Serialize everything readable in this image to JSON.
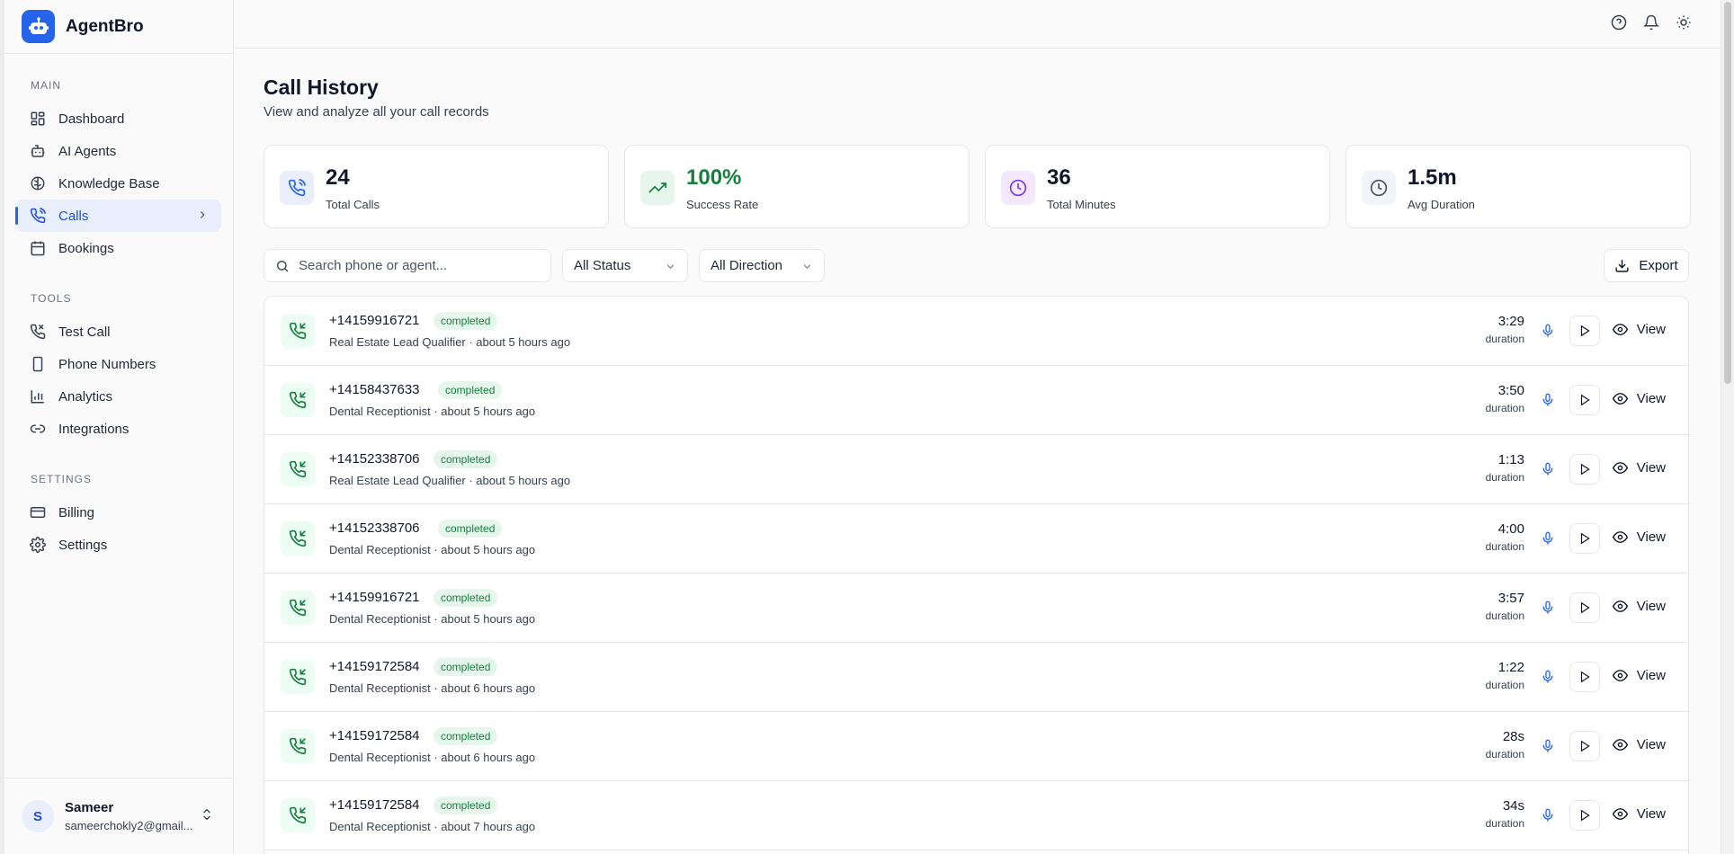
{
  "app": {
    "name": "AgentBro"
  },
  "sidebar": {
    "sections": [
      {
        "label": "MAIN",
        "items": [
          {
            "label": "Dashboard",
            "icon": "dashboard-icon"
          },
          {
            "label": "AI Agents",
            "icon": "robot-icon"
          },
          {
            "label": "Knowledge Base",
            "icon": "brain-icon"
          },
          {
            "label": "Calls",
            "icon": "phone-icon",
            "active": true
          },
          {
            "label": "Bookings",
            "icon": "calendar-icon"
          }
        ]
      },
      {
        "label": "TOOLS",
        "items": [
          {
            "label": "Test Call",
            "icon": "phone-call-icon"
          },
          {
            "label": "Phone Numbers",
            "icon": "smartphone-icon"
          },
          {
            "label": "Analytics",
            "icon": "bar-chart-icon"
          },
          {
            "label": "Integrations",
            "icon": "link-icon"
          }
        ]
      },
      {
        "label": "SETTINGS",
        "items": [
          {
            "label": "Billing",
            "icon": "credit-card-icon"
          },
          {
            "label": "Settings",
            "icon": "gear-icon"
          }
        ]
      }
    ]
  },
  "user": {
    "initial": "S",
    "name": "Sameer",
    "email": "sameerchokly2@gmail..."
  },
  "page": {
    "title": "Call History",
    "subtitle": "View and analyze all your call records"
  },
  "stats": [
    {
      "value": "24",
      "label": "Total Calls",
      "color": "#2563eb"
    },
    {
      "value": "100%",
      "label": "Success Rate",
      "color": "#15803d"
    },
    {
      "value": "36",
      "label": "Total Minutes",
      "color": "#7c3aed"
    },
    {
      "value": "1.5m",
      "label": "Avg Duration",
      "color": "#475569"
    }
  ],
  "filters": {
    "search_placeholder": "Search phone or agent...",
    "status": "All Status",
    "direction": "All Direction",
    "export_label": "Export"
  },
  "calls": [
    {
      "phone": "+14159916721",
      "status": "completed",
      "meta": "Real Estate Lead Qualifier · about 5 hours ago",
      "duration": "3:29"
    },
    {
      "phone": "+14158437633",
      "status": "completed",
      "meta": "Dental Receptionist · about 5 hours ago",
      "duration": "3:50"
    },
    {
      "phone": "+14152338706",
      "status": "completed",
      "meta": "Real Estate Lead Qualifier · about 5 hours ago",
      "duration": "1:13"
    },
    {
      "phone": "+14152338706",
      "status": "completed",
      "meta": "Dental Receptionist · about 5 hours ago",
      "duration": "4:00"
    },
    {
      "phone": "+14159916721",
      "status": "completed",
      "meta": "Dental Receptionist · about 5 hours ago",
      "duration": "3:57"
    },
    {
      "phone": "+14159172584",
      "status": "completed",
      "meta": "Dental Receptionist · about 6 hours ago",
      "duration": "1:22"
    },
    {
      "phone": "+14159172584",
      "status": "completed",
      "meta": "Dental Receptionist · about 6 hours ago",
      "duration": "28s"
    },
    {
      "phone": "+14159172584",
      "status": "completed",
      "meta": "Dental Receptionist · about 7 hours ago",
      "duration": "34s"
    }
  ],
  "labels": {
    "duration": "duration",
    "view": "View"
  }
}
